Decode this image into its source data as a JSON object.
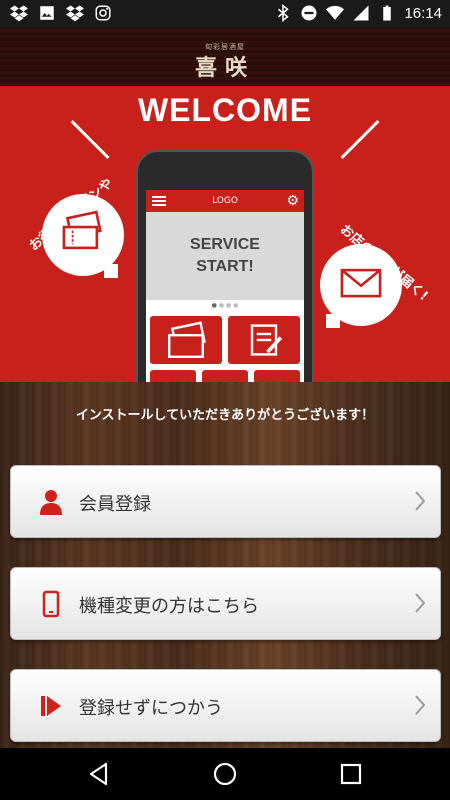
{
  "status_bar": {
    "time": "16:14",
    "left_icons": [
      "dropbox-icon",
      "image-icon",
      "dropbox-icon",
      "instagram-icon"
    ],
    "right_icons": [
      "bluetooth-icon",
      "do-not-disturb-icon",
      "wifi-icon",
      "signal-icon",
      "battery-icon"
    ]
  },
  "header": {
    "subtitle": "旬彩居酒屋",
    "brand": "喜咲"
  },
  "hero": {
    "title": "WELCOME",
    "left_caption": "お得なクーポンや",
    "right_caption": "お店の情報が届く!",
    "phone": {
      "logo": "LOGO",
      "service_line1": "SERVICE",
      "service_line2": "START!"
    }
  },
  "main": {
    "thanks_message": "インストールしていただきありがとうございます！",
    "buttons": [
      {
        "label": "会員登録",
        "icon": "person-icon"
      },
      {
        "label": "機種変更の方はこちら",
        "icon": "smartphone-icon"
      },
      {
        "label": "登録せずにつかう",
        "icon": "skip-icon"
      }
    ]
  },
  "colors": {
    "accent": "#c8201b",
    "icon_red": "#d0221c"
  },
  "nav": {
    "buttons": [
      "back-icon",
      "home-icon",
      "recents-icon"
    ]
  }
}
